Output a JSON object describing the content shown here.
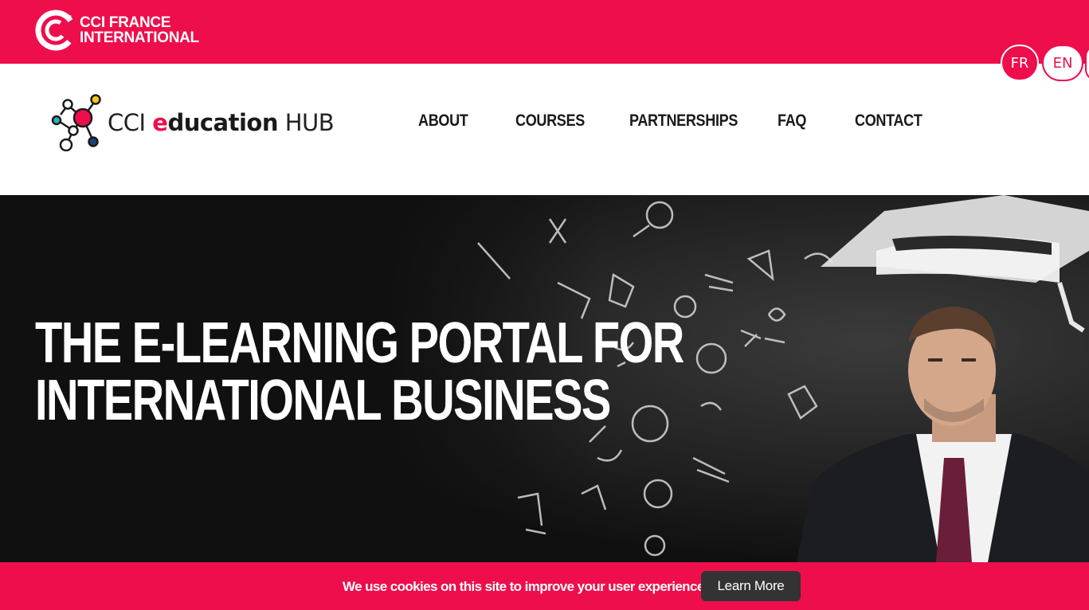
{
  "topbar": {
    "brand_line1": "CCI FRANCE",
    "brand_line2": "INTERNATIONAL",
    "color": "#ee0e4c"
  },
  "language": {
    "options": [
      "FR",
      "EN"
    ],
    "selected": "FR"
  },
  "header": {
    "logo": {
      "prefix": "CCI ",
      "edu_first": "e",
      "edu_rest": "ducation",
      "suffix": " HUB"
    },
    "nav": [
      {
        "label": "ABOUT"
      },
      {
        "label": "COURSES"
      },
      {
        "label": "PARTNERSHIPS"
      },
      {
        "label": "FAQ"
      },
      {
        "label": "CONTACT"
      }
    ]
  },
  "hero": {
    "title_line1": "THE E-LEARNING PORTAL FOR",
    "title_line2": "INTERNATIONAL BUSINESS",
    "image": "chalkboard-graduation-businessman"
  },
  "cookie": {
    "text": "We use cookies on this site to improve your user experience.",
    "button_label": "Learn More"
  },
  "colors": {
    "accent": "#ee0e4c",
    "dark": "#101010",
    "button": "#333333"
  }
}
